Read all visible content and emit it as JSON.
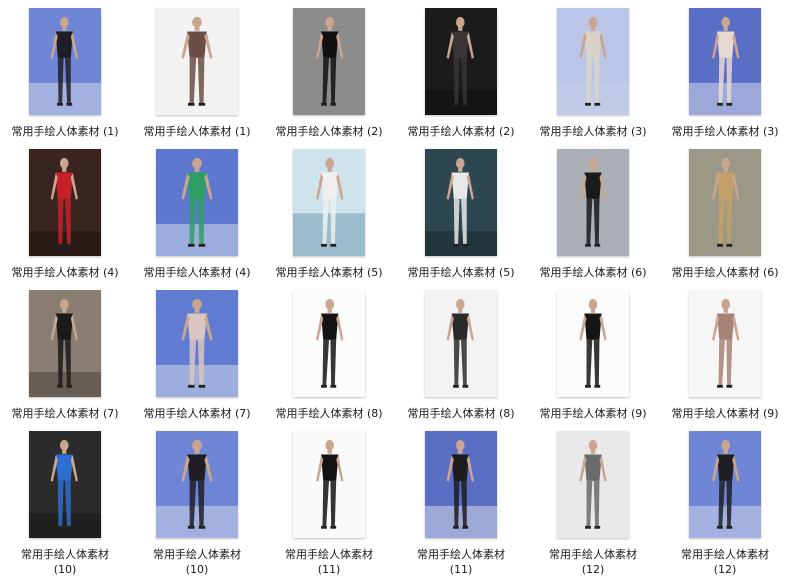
{
  "files": [
    {
      "name": "常用手绘人体素材 (1)",
      "bg": "#6f86d6",
      "fig": "#1e1e24",
      "theme": "runway"
    },
    {
      "name": "常用手绘人体素材 (1)",
      "bg": "#f2f2f2",
      "fig": "#6b4f46",
      "theme": "studio"
    },
    {
      "name": "常用手绘人体素材 (2)",
      "bg": "#8c8c8c",
      "fig": "#111111",
      "theme": "gray"
    },
    {
      "name": "常用手绘人体素材 (2)",
      "bg": "#1b1b1b",
      "fig": "#3a3536",
      "theme": "dark"
    },
    {
      "name": "常用手绘人体素材 (3)",
      "bg": "#b9c6e8",
      "fig": "#d9d3c7",
      "theme": "runway"
    },
    {
      "name": "常用手绘人体素材 (3)",
      "bg": "#5a6ec6",
      "fig": "#e6d9d2",
      "theme": "runway"
    },
    {
      "name": "常用手绘人体素材 (4)",
      "bg": "#3a2420",
      "fig": "#c8202a",
      "theme": "dark"
    },
    {
      "name": "常用手绘人体素材 (4)",
      "bg": "#5e78d0",
      "fig": "#2d9f63",
      "theme": "runway"
    },
    {
      "name": "常用手绘人体素材 (5)",
      "bg": "#cfe3ec",
      "fig": "#efefef",
      "theme": "sky"
    },
    {
      "name": "常用手绘人体素材 (5)",
      "bg": "#2d4750",
      "fig": "#e8e8e8",
      "theme": "dark"
    },
    {
      "name": "常用手绘人体素材 (6)",
      "bg": "#aab0b6",
      "fig": "#1a1a1a",
      "theme": "gray"
    },
    {
      "name": "常用手绘人体素材 (6)",
      "bg": "#9c9888",
      "fig": "#c3a06a",
      "theme": "gray"
    },
    {
      "name": "常用手绘人体素材 (7)",
      "bg": "#8a7d72",
      "fig": "#1a1a1a",
      "theme": "dark"
    },
    {
      "name": "常用手绘人体素材 (7)",
      "bg": "#5f7bd2",
      "fig": "#d9c6c0",
      "theme": "runway"
    },
    {
      "name": "常用手绘人体素材 (8)",
      "bg": "#fbfbfb",
      "fig": "#141414",
      "theme": "studio"
    },
    {
      "name": "常用手绘人体素材 (8)",
      "bg": "#f3f3f3",
      "fig": "#2a2a2a",
      "theme": "studio"
    },
    {
      "name": "常用手绘人体素材 (9)",
      "bg": "#fbfbfb",
      "fig": "#151515",
      "theme": "studio"
    },
    {
      "name": "常用手绘人体素材 (9)",
      "bg": "#f6f6f6",
      "fig": "#a68376",
      "theme": "studio"
    },
    {
      "name": "常用手绘人体素材 (10)",
      "bg": "#2b2b2b",
      "fig": "#2c6fd1",
      "theme": "dark"
    },
    {
      "name": "常用手绘人体素材 (10)",
      "bg": "#6f86d6",
      "fig": "#1e1e24",
      "theme": "runway"
    },
    {
      "name": "常用手绘人体素材 (11)",
      "bg": "#fafafa",
      "fig": "#121212",
      "theme": "studio"
    },
    {
      "name": "常用手绘人体素材 (11)",
      "bg": "#5a6fc4",
      "fig": "#1c1c1c",
      "theme": "runway"
    },
    {
      "name": "常用手绘人体素材 (12)",
      "bg": "#e9e9e9",
      "fig": "#6a6a6a",
      "theme": "gray"
    },
    {
      "name": "常用手绘人体素材 (12)",
      "bg": "#6f86d6",
      "fig": "#1e1e24",
      "theme": "runway"
    }
  ]
}
